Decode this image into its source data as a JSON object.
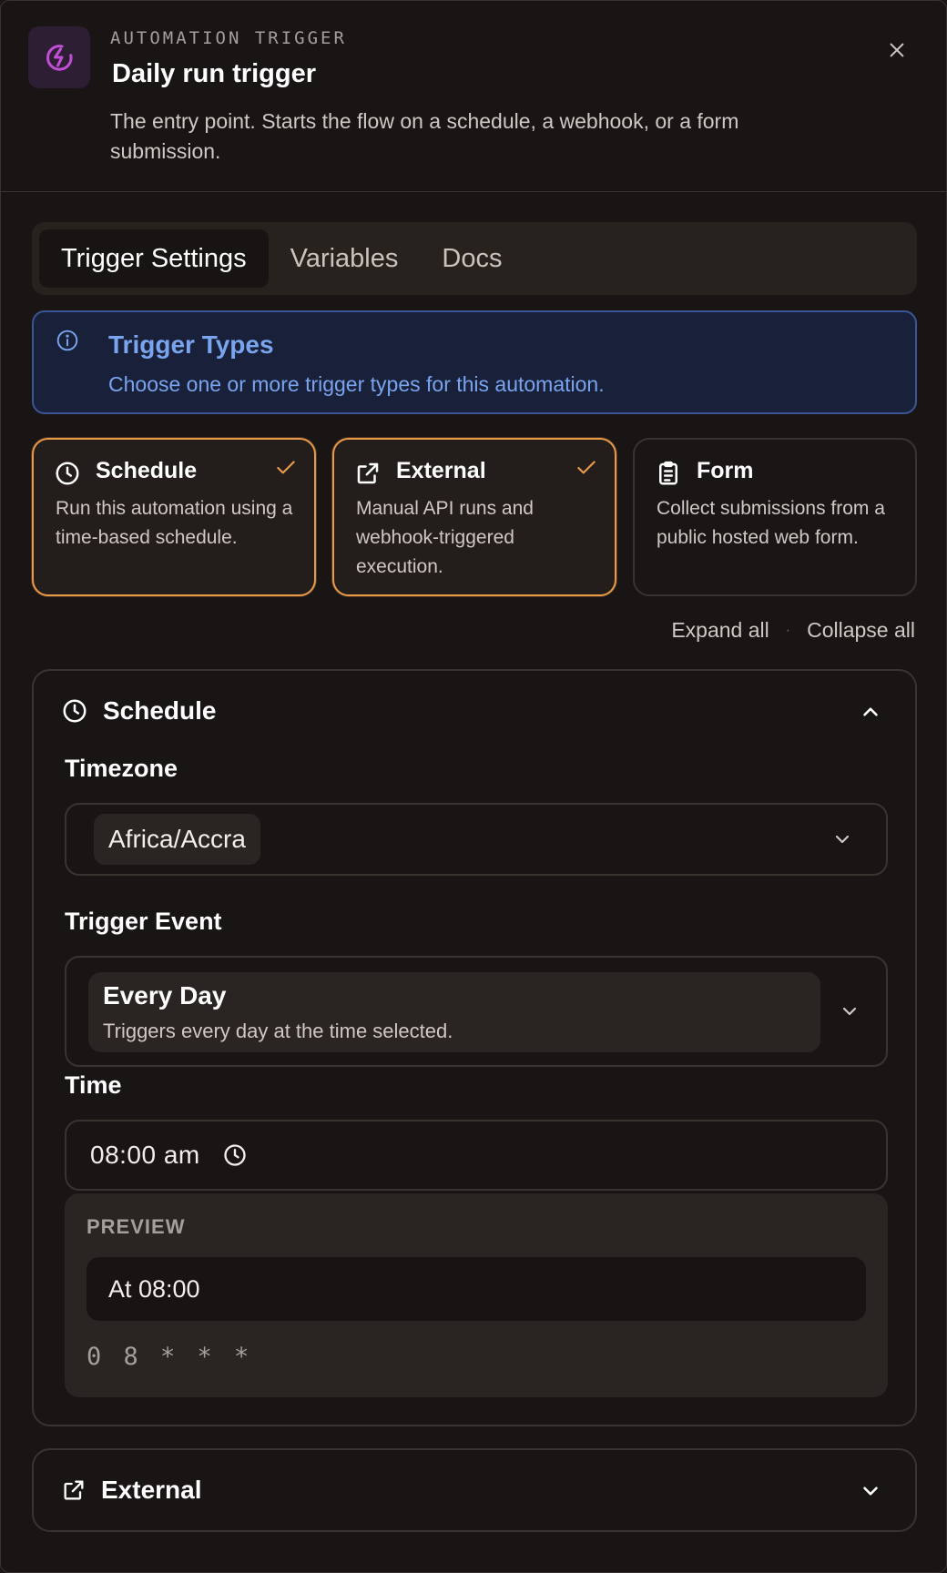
{
  "header": {
    "eyebrow": "AUTOMATION TRIGGER",
    "title": "Daily run trigger",
    "description": "The entry point. Starts the flow on a schedule, a webhook, or a form submission.",
    "icon": "lightning-circle-icon",
    "accent": "#c04fd6"
  },
  "tabs": [
    {
      "label": "Trigger Settings",
      "active": true
    },
    {
      "label": "Variables",
      "active": false
    },
    {
      "label": "Docs",
      "active": false
    }
  ],
  "info": {
    "title": "Trigger Types",
    "text": "Choose one or more trigger types for this automation.",
    "color": "#7aa4ee"
  },
  "trigger_types": [
    {
      "name": "Schedule",
      "description": "Run this automation using a time-based schedule.",
      "selected": true,
      "icon": "clock-icon"
    },
    {
      "name": "External",
      "description": "Manual API runs and webhook-triggered execution.",
      "selected": true,
      "icon": "external-link-icon"
    },
    {
      "name": "Form",
      "description": "Collect submissions from a public hosted web form.",
      "selected": false,
      "icon": "clipboard-icon"
    }
  ],
  "selection_color": "#e89a4a",
  "expand_controls": {
    "expand_all": "Expand all",
    "separator": "·",
    "collapse_all": "Collapse all"
  },
  "schedule_section": {
    "title": "Schedule",
    "expanded": true,
    "timezone_label": "Timezone",
    "timezone_value": "Africa/Accra",
    "trigger_event_label": "Trigger Event",
    "trigger_event_value": "Every Day",
    "trigger_event_description": "Triggers every day at the time selected.",
    "time_label": "Time",
    "time_value": "08:00  am",
    "preview_label": "PREVIEW",
    "preview_text": "At 08:00",
    "cron": "0 8 * * *"
  },
  "external_section": {
    "title": "External",
    "expanded": false
  }
}
